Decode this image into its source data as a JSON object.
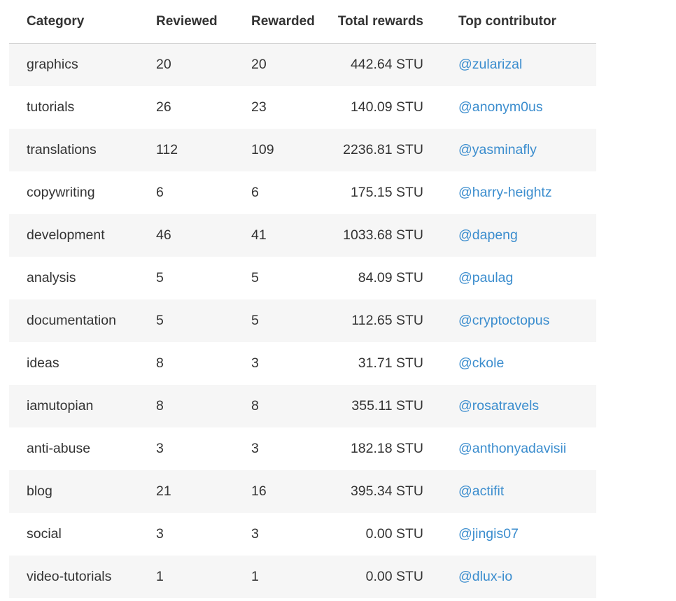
{
  "table": {
    "headers": {
      "category": "Category",
      "reviewed": "Reviewed",
      "rewarded": "Rewarded",
      "total_rewards": "Total rewards",
      "top_contributor": "Top contributor"
    },
    "rows": [
      {
        "category": "graphics",
        "reviewed": "20",
        "rewarded": "20",
        "total_rewards": "442.64 STU",
        "top_contributor": "@zularizal"
      },
      {
        "category": "tutorials",
        "reviewed": "26",
        "rewarded": "23",
        "total_rewards": "140.09 STU",
        "top_contributor": "@anonym0us"
      },
      {
        "category": "translations",
        "reviewed": "112",
        "rewarded": "109",
        "total_rewards": "2236.81 STU",
        "top_contributor": "@yasminafly"
      },
      {
        "category": "copywriting",
        "reviewed": "6",
        "rewarded": "6",
        "total_rewards": "175.15 STU",
        "top_contributor": "@harry-heightz"
      },
      {
        "category": "development",
        "reviewed": "46",
        "rewarded": "41",
        "total_rewards": "1033.68 STU",
        "top_contributor": "@dapeng"
      },
      {
        "category": "analysis",
        "reviewed": "5",
        "rewarded": "5",
        "total_rewards": "84.09 STU",
        "top_contributor": "@paulag"
      },
      {
        "category": "documentation",
        "reviewed": "5",
        "rewarded": "5",
        "total_rewards": "112.65 STU",
        "top_contributor": "@cryptoctopus"
      },
      {
        "category": "ideas",
        "reviewed": "8",
        "rewarded": "3",
        "total_rewards": "31.71 STU",
        "top_contributor": "@ckole"
      },
      {
        "category": "iamutopian",
        "reviewed": "8",
        "rewarded": "8",
        "total_rewards": "355.11 STU",
        "top_contributor": "@rosatravels"
      },
      {
        "category": "anti-abuse",
        "reviewed": "3",
        "rewarded": "3",
        "total_rewards": "182.18 STU",
        "top_contributor": "@anthonyadavisii"
      },
      {
        "category": "blog",
        "reviewed": "21",
        "rewarded": "16",
        "total_rewards": "395.34 STU",
        "top_contributor": "@actifit"
      },
      {
        "category": "social",
        "reviewed": "3",
        "rewarded": "3",
        "total_rewards": "0.00 STU",
        "top_contributor": "@jingis07"
      },
      {
        "category": "video-tutorials",
        "reviewed": "1",
        "rewarded": "1",
        "total_rewards": "0.00 STU",
        "top_contributor": "@dlux-io"
      }
    ]
  },
  "colors": {
    "link": "#3b8dce",
    "stripe": "#f6f6f6",
    "text": "#333333"
  }
}
